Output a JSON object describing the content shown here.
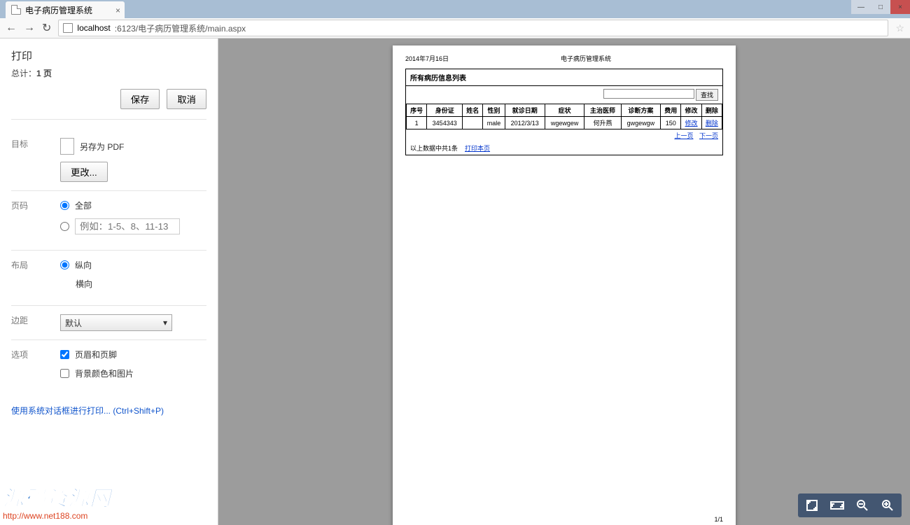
{
  "chrome": {
    "tab_title": "电子病历管理系统",
    "url_host": "localhost",
    "url_port_path": ":6123/电子病历管理系统/main.aspx"
  },
  "print": {
    "title": "打印",
    "total_prefix": "总计：",
    "total_count": "1 页",
    "save": "保存",
    "cancel": "取消",
    "dest_label": "目标",
    "dest_value": "另存为 PDF",
    "change": "更改...",
    "pages_label": "页码",
    "pages_all": "全部",
    "pages_placeholder": "例如：1-5、8、11-13",
    "layout_label": "布局",
    "layout_portrait": "纵向",
    "layout_landscape": "横向",
    "margins_label": "边距",
    "margins_value": "默认",
    "options_label": "选项",
    "opt_headers": "页眉和页脚",
    "opt_bg": "背景颜色和图片",
    "system_link": "使用系统对话框进行打印... (Ctrl+Shift+P)"
  },
  "preview": {
    "date": "2014年7月16日",
    "system": "电子病历管理系统",
    "list_title": "所有病历信息列表",
    "search_btn": "查找",
    "columns": [
      "序号",
      "身份证",
      "姓名",
      "性别",
      "就诊日期",
      "症状",
      "主治医师",
      "诊断方案",
      "费用",
      "修改",
      "删除"
    ],
    "row": {
      "c0": "1",
      "c1": "3454343",
      "c2": "",
      "c3": "male",
      "c4": "2012/3/13",
      "c5": "wgewgew",
      "c6": "何升燕",
      "c7": "gwgewgw",
      "c8": "150",
      "c9": "修改",
      "c10": "删除"
    },
    "prev": "上一页",
    "next": "下一页",
    "footer_text": "以上数据中共1条",
    "print_link": "打印本页",
    "page_num": "1/1"
  },
  "watermark": {
    "text": "源码资源网",
    "url": "http://www.net188.com"
  }
}
